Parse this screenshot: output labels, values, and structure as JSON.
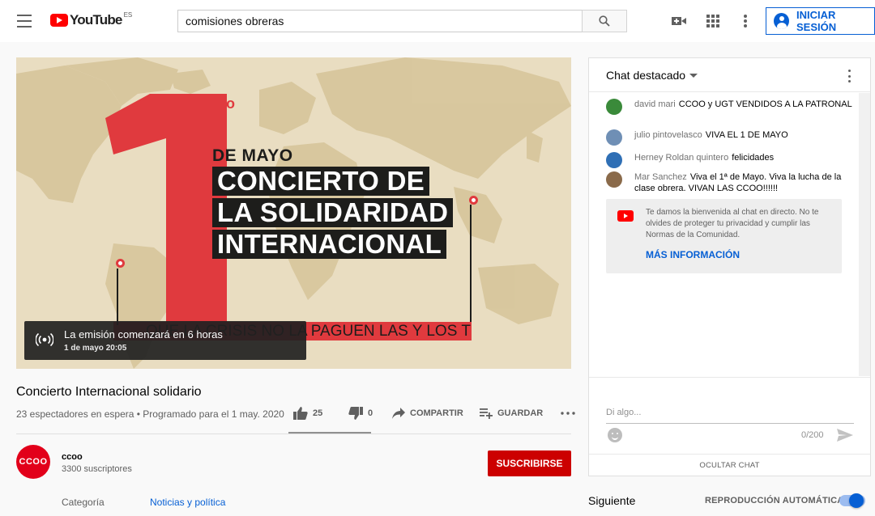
{
  "header": {
    "logo_text": "YouTube",
    "logo_country": "ES",
    "search_value": "comisiones obreras",
    "signin_label": "INICIAR SESIÓN",
    "accent_color": "#065fd4",
    "brand_color": "#ff0000"
  },
  "video": {
    "ordinal": "o",
    "line_mayo": "DE MAYO",
    "banner_1": "CONCIERTO DE",
    "banner_2": "LA SOLIDARIDAD",
    "banner_3": "INTERNACIONAL",
    "strip_text": "QUE LA CRISIS NO LA PAGUEN LAS Y LOS TRABAJADORES",
    "live_title": "La emisión comenzará en 6 horas",
    "live_sub": "1 de mayo 20:05"
  },
  "info": {
    "title": "Concierto Internacional solidario",
    "meta": "23 espectadores en espera • Programado para el 1 may. 2020",
    "likes": "25",
    "dislikes": "0",
    "share_label": "COMPARTIR",
    "save_label": "GUARDAR"
  },
  "channel": {
    "avatar_text": "CCOO",
    "name": "ccoo",
    "subs": "3300 suscriptores",
    "subscribe_label": "SUSCRIBIRSE",
    "category_label": "Categoría",
    "category_value": "Noticias y política"
  },
  "chat": {
    "title": "Chat destacado",
    "messages": [
      {
        "author": "david mari",
        "text": "CCOO y UGT VENDIDOS A LA PATRONAL",
        "avatar_color": "#3a8a3a"
      },
      {
        "author": "julio pintovelasco",
        "text": "VIVA EL 1 DE MAYO",
        "avatar_color": "#6f8fb5"
      },
      {
        "author": "Herney Roldan quintero",
        "text": "felicidades",
        "avatar_color": "#2f6fb5"
      },
      {
        "author": "Mar Sanchez",
        "text": "Viva el 1ª de Mayo. Viva la lucha de la clase obrera. VIVAN LAS CCOO!!!!!!",
        "avatar_color": "#8a6a4a"
      }
    ],
    "welcome_text": "Te damos la bienvenida al chat en directo. No te olvides de proteger tu privacidad y cumplir las Normas de la Comunidad.",
    "welcome_link": "MÁS INFORMACIÓN",
    "input_placeholder": "Di algo...",
    "counter": "0/200",
    "hide_label": "OCULTAR CHAT"
  },
  "sidebar": {
    "next_label": "Siguiente",
    "autoplay_label": "REPRODUCCIÓN AUTOMÁTICA",
    "autoplay_on": true
  }
}
